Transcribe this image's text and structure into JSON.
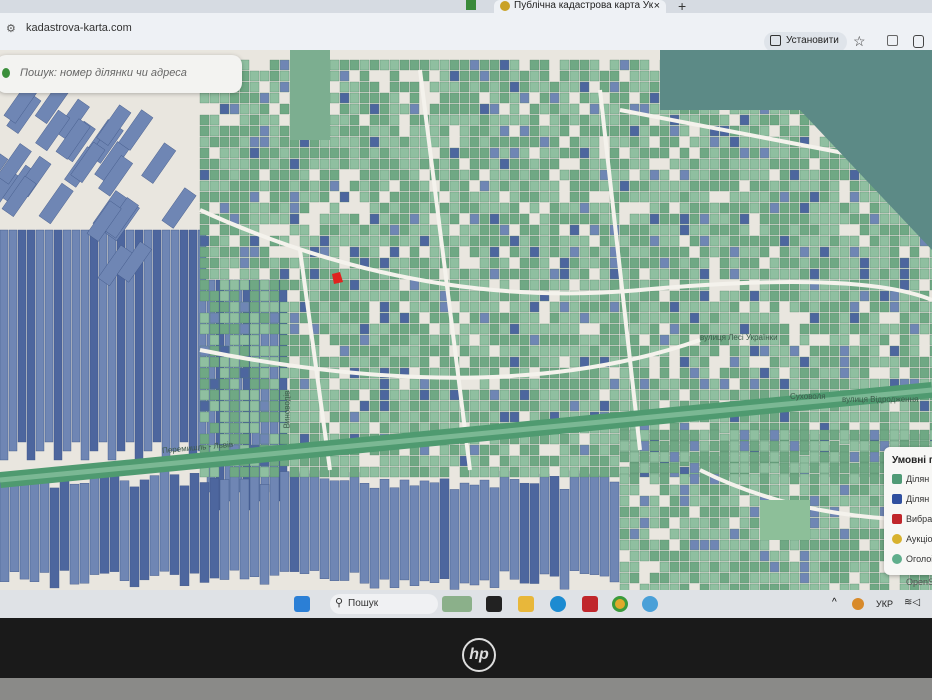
{
  "browser": {
    "active_tab": "Публічна кадастрова карта Ук",
    "url": "kadastrova-karta.com",
    "install_label": "Установити"
  },
  "map": {
    "search_placeholder": "Пошук: номер ділянки чи адреса",
    "streets": [
      "вулиця Лесі Українки",
      "Суховоля",
      "вулиця Відродження",
      "Перемишль - Львів",
      "Виноводів"
    ],
    "legend": {
      "title": "Умовні п",
      "items": [
        {
          "label": "Ділян",
          "color": "#4f9a76"
        },
        {
          "label": "Ділян",
          "color": "#2f4f9f"
        },
        {
          "label": "Вибра",
          "color": "#c0262b"
        },
        {
          "label": "Аукціо",
          "color": "#d8b22e"
        },
        {
          "label": "Оголоі",
          "color": "#5fae8c"
        }
      ]
    },
    "attribution": "OpenS"
  },
  "taskbar": {
    "search_label": "Пошук",
    "language": "УКР"
  },
  "laptop": {
    "brand": "hp"
  }
}
